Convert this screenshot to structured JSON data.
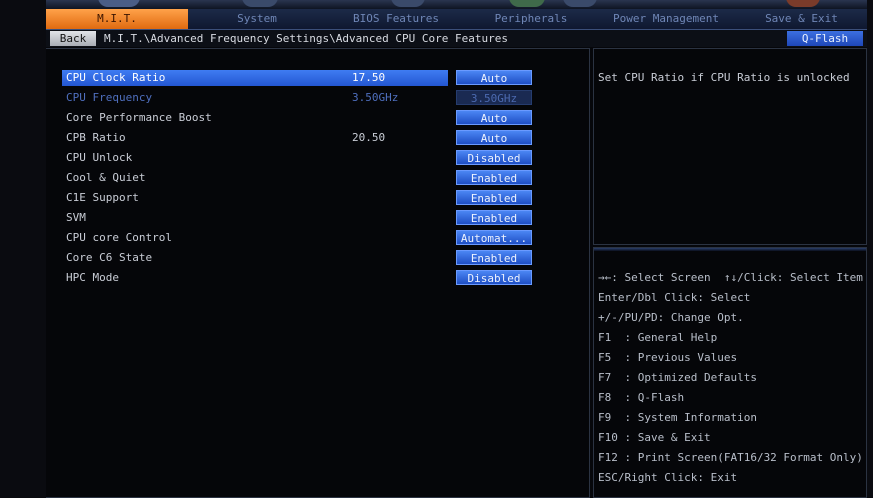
{
  "tabs": [
    {
      "label": "M.I.T.",
      "active": true
    },
    {
      "label": "System",
      "active": false
    },
    {
      "label": "BIOS Features",
      "active": false
    },
    {
      "label": "Peripherals",
      "active": false
    },
    {
      "label": "Power Management",
      "active": false
    },
    {
      "label": "Save & Exit",
      "active": false
    }
  ],
  "nav": {
    "back_label": "Back",
    "breadcrumb": "M.I.T.\\Advanced Frequency Settings\\Advanced CPU Core Features",
    "qflash_label": "Q-Flash"
  },
  "settings": [
    {
      "label": "CPU Clock Ratio",
      "value": "17.50",
      "option": "Auto",
      "selected": true,
      "disabled": false
    },
    {
      "label": "CPU Frequency",
      "value": "3.50GHz",
      "option": "3.50GHz",
      "selected": false,
      "disabled": true
    },
    {
      "label": "Core Performance Boost",
      "value": "",
      "option": "Auto",
      "selected": false,
      "disabled": false
    },
    {
      "label": "CPB Ratio",
      "value": "20.50",
      "option": "Auto",
      "selected": false,
      "disabled": false
    },
    {
      "label": "CPU Unlock",
      "value": "",
      "option": "Disabled",
      "selected": false,
      "disabled": false
    },
    {
      "label": "Cool & Quiet",
      "value": "",
      "option": "Enabled",
      "selected": false,
      "disabled": false
    },
    {
      "label": "C1E Support",
      "value": "",
      "option": "Enabled",
      "selected": false,
      "disabled": false
    },
    {
      "label": "SVM",
      "value": "",
      "option": "Enabled",
      "selected": false,
      "disabled": false
    },
    {
      "label": "CPU core Control",
      "value": "",
      "option": "Automat...",
      "selected": false,
      "disabled": false
    },
    {
      "label": "Core C6 State",
      "value": "",
      "option": "Enabled",
      "selected": false,
      "disabled": false
    },
    {
      "label": "HPC Mode",
      "value": "",
      "option": "Disabled",
      "selected": false,
      "disabled": false
    }
  ],
  "help": {
    "text": "Set CPU Ratio if CPU Ratio is unlocked"
  },
  "keys": [
    "→←: Select Screen  ↑↓/Click: Select Item",
    "Enter/Dbl Click: Select",
    "+/-/PU/PD: Change Opt.",
    "F1  : General Help",
    "F5  : Previous Values",
    "F7  : Optimized Defaults",
    "F8  : Q-Flash",
    "F9  : System Information",
    "F10 : Save & Exit",
    "F12 : Print Screen(FAT16/32 Format Only)",
    "ESC/Right Click: Exit"
  ],
  "colors": {
    "accent_tab": "#e06a10",
    "highlight": "#2f66e0",
    "option_button": "#2d62d8",
    "text": "#c9cdd6",
    "disabled_text": "#4f6fbe"
  }
}
